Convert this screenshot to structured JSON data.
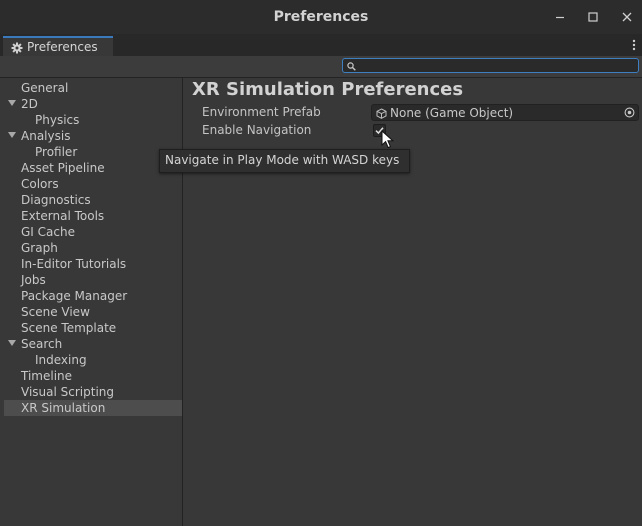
{
  "window": {
    "title": "Preferences"
  },
  "tab": {
    "label": "Preferences",
    "icon": "gear-icon"
  },
  "search": {
    "value": "",
    "placeholder": ""
  },
  "sidebar": {
    "items": [
      {
        "label": "General",
        "indent": 0,
        "expandable": false,
        "selected": false
      },
      {
        "label": "2D",
        "indent": 0,
        "expandable": true,
        "selected": false
      },
      {
        "label": "Physics",
        "indent": 1,
        "expandable": false,
        "selected": false
      },
      {
        "label": "Analysis",
        "indent": 0,
        "expandable": true,
        "selected": false
      },
      {
        "label": "Profiler",
        "indent": 1,
        "expandable": false,
        "selected": false
      },
      {
        "label": "Asset Pipeline",
        "indent": 0,
        "expandable": false,
        "selected": false
      },
      {
        "label": "Colors",
        "indent": 0,
        "expandable": false,
        "selected": false
      },
      {
        "label": "Diagnostics",
        "indent": 0,
        "expandable": false,
        "selected": false
      },
      {
        "label": "External Tools",
        "indent": 0,
        "expandable": false,
        "selected": false
      },
      {
        "label": "GI Cache",
        "indent": 0,
        "expandable": false,
        "selected": false
      },
      {
        "label": "Graph",
        "indent": 0,
        "expandable": false,
        "selected": false
      },
      {
        "label": "In-Editor Tutorials",
        "indent": 0,
        "expandable": false,
        "selected": false
      },
      {
        "label": "Jobs",
        "indent": 0,
        "expandable": false,
        "selected": false
      },
      {
        "label": "Package Manager",
        "indent": 0,
        "expandable": false,
        "selected": false
      },
      {
        "label": "Scene View",
        "indent": 0,
        "expandable": false,
        "selected": false
      },
      {
        "label": "Scene Template",
        "indent": 0,
        "expandable": false,
        "selected": false
      },
      {
        "label": "Search",
        "indent": 0,
        "expandable": true,
        "selected": false
      },
      {
        "label": "Indexing",
        "indent": 1,
        "expandable": false,
        "selected": false
      },
      {
        "label": "Timeline",
        "indent": 0,
        "expandable": false,
        "selected": false
      },
      {
        "label": "Visual Scripting",
        "indent": 0,
        "expandable": false,
        "selected": false
      },
      {
        "label": "XR Simulation",
        "indent": 0,
        "expandable": false,
        "selected": true
      }
    ]
  },
  "main": {
    "title": "XR Simulation Preferences",
    "environment_prefab": {
      "label": "Environment Prefab",
      "value": "None (Game Object)"
    },
    "enable_navigation": {
      "label": "Enable Navigation",
      "checked": true
    },
    "tooltip": "Navigate in Play Mode with WASD keys"
  },
  "colors": {
    "accent": "#3a79bb",
    "selection": "#4d4d4d",
    "background": "#383838"
  }
}
